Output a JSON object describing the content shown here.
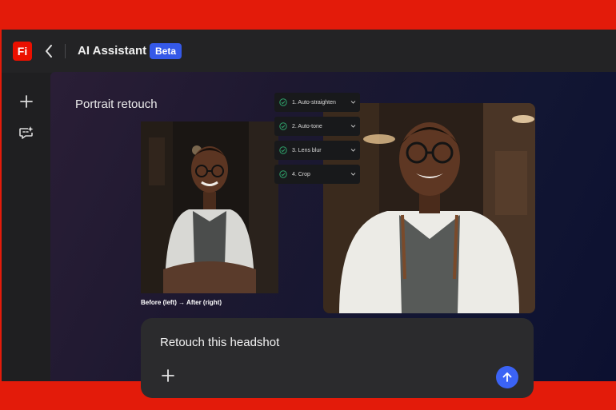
{
  "header": {
    "logo_text": "Fi",
    "title": "AI Assistant",
    "badge": "Beta"
  },
  "sidebar": {
    "items": [
      {
        "icon": "plus-icon"
      },
      {
        "icon": "chat-sparkle-icon"
      }
    ]
  },
  "main": {
    "section_title": "Portrait retouch",
    "caption": "Before (left) → After (right)",
    "steps": [
      {
        "label": "1. Auto-straighten"
      },
      {
        "label": "2. Auto-tone"
      },
      {
        "label": "3. Lens blur"
      },
      {
        "label": "4. Crop"
      }
    ]
  },
  "prompt": {
    "text": "Retouch this headshot"
  },
  "colors": {
    "brand": "#eb1000",
    "accent": "#3b63f5",
    "badge": "#3559e8"
  }
}
